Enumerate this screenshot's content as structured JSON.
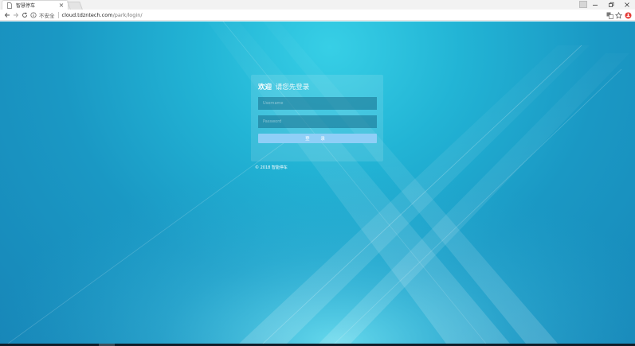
{
  "browser": {
    "tab": {
      "title": "智慧停车",
      "close_glyph": "×"
    },
    "window_controls": {
      "minimize": "–",
      "restore": "❐",
      "close": "✕"
    },
    "address_bar": {
      "security_label": "不安全",
      "host": "cloud.tdzntech.com",
      "path": "/park/login/"
    },
    "icons": {
      "back": "arrow-left-icon",
      "forward": "arrow-right-icon",
      "reload": "reload-icon",
      "info": "info-icon",
      "translate": "translate-icon",
      "bookmark": "star-icon",
      "extension": "extension-icon"
    }
  },
  "login": {
    "heading_strong": "欢迎",
    "heading_rest": "请您先登录",
    "username_placeholder": "Username",
    "password_placeholder": "Password",
    "submit_label": "登 录",
    "copyright": "© 2018 智能停车"
  },
  "colors": {
    "background_light": "#37cfe6",
    "background_dark": "#1786b8",
    "button": "#8fcff7",
    "extension_icon": "#e53935"
  }
}
